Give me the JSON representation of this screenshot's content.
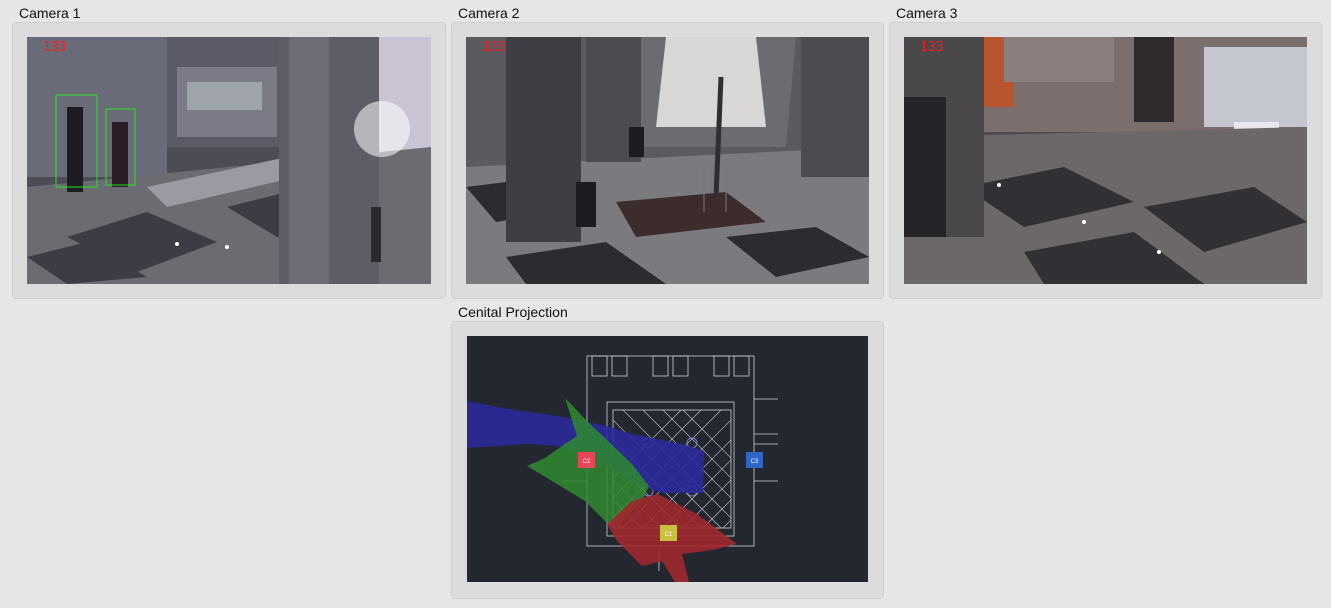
{
  "cameras": [
    {
      "title": "Camera 1",
      "frame": "133"
    },
    {
      "title": "Camera 2",
      "frame": "133"
    },
    {
      "title": "Camera 3",
      "frame": "133"
    }
  ],
  "projection": {
    "title": "Cenital Projection",
    "markers": {
      "c1": "C1",
      "c2": "C2",
      "c3": "C3"
    },
    "colors": {
      "background": "#23272f",
      "camera1": "#c9c040",
      "camera2": "#e8455a",
      "camera3": "#2f64c8",
      "fov1": "#a0282f",
      "fov2": "#2f8a30",
      "fov3": "#2a2a9a"
    }
  }
}
